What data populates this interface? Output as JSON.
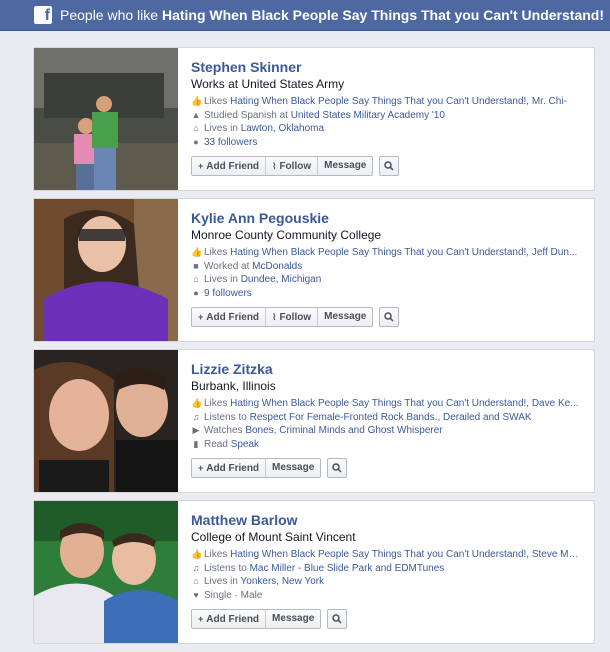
{
  "header": {
    "prefix": "People who like ",
    "page_name": "Hating When Black People Say Things That you Can't Understand!",
    "colors": {
      "bar": "#4e69a2",
      "link": "#3b5998"
    }
  },
  "people": [
    {
      "name": "Stephen Skinner",
      "subtitle": "Works at United States Army",
      "lines": [
        {
          "icon": "thumbs-up-icon",
          "text": "Likes ",
          "link": "Hating When Black People Say Things That you Can't Understand!, Mr. Chi-"
        },
        {
          "icon": "graduation-icon",
          "text": "Studied Spanish at ",
          "link": "United States Military Academy '10"
        },
        {
          "icon": "home-icon",
          "text": "Lives in ",
          "link": "Lawton, Oklahoma"
        },
        {
          "icon": "followers-icon",
          "text": "",
          "link": "33 followers"
        }
      ],
      "buttons": [
        "Add Friend",
        "Follow",
        "Message"
      ]
    },
    {
      "name": "Kylie Ann Pegouskie",
      "subtitle": "Monroe County Community College",
      "lines": [
        {
          "icon": "thumbs-up-icon",
          "text": "Likes ",
          "link": "Hating When Black People Say Things That you Can't Understand!, Jeff Dun..."
        },
        {
          "icon": "briefcase-icon",
          "text": "Worked at ",
          "link": "McDonalds"
        },
        {
          "icon": "home-icon",
          "text": "Lives in ",
          "link": "Dundee, Michigan"
        },
        {
          "icon": "followers-icon",
          "text": "",
          "link": "9 followers"
        }
      ],
      "buttons": [
        "Add Friend",
        "Follow",
        "Message"
      ]
    },
    {
      "name": "Lizzie Zitzka",
      "subtitle": "Burbank, Illinois",
      "lines": [
        {
          "icon": "thumbs-up-icon",
          "text": "Likes ",
          "link": "Hating When Black People Say Things That you Can't Understand!, Dave Ke..."
        },
        {
          "icon": "music-icon",
          "text": "Listens to ",
          "link": "Respect For Female-Fronted Rock Bands., Derailed and SWAK"
        },
        {
          "icon": "tv-icon",
          "text": "Watches ",
          "link": "Bones, Criminal Minds and Ghost Whisperer"
        },
        {
          "icon": "book-icon",
          "text": "Read ",
          "link": "Speak"
        }
      ],
      "buttons": [
        "Add Friend",
        "Message"
      ]
    },
    {
      "name": "Matthew Barlow",
      "subtitle": "College of Mount Saint Vincent",
      "lines": [
        {
          "icon": "thumbs-up-icon",
          "text": "Likes ",
          "link": "Hating When Black People Say Things That you Can't Understand!, Steve Ma..."
        },
        {
          "icon": "music-icon",
          "text": "Listens to ",
          "link": "Mac Miller - Blue Slide Park and EDMTunes"
        },
        {
          "icon": "home-icon",
          "text": "Lives in ",
          "link": "Yonkers, New York"
        },
        {
          "icon": "heart-icon",
          "text": "Single · Male",
          "link": ""
        }
      ],
      "buttons": [
        "Add Friend",
        "Message"
      ]
    }
  ]
}
